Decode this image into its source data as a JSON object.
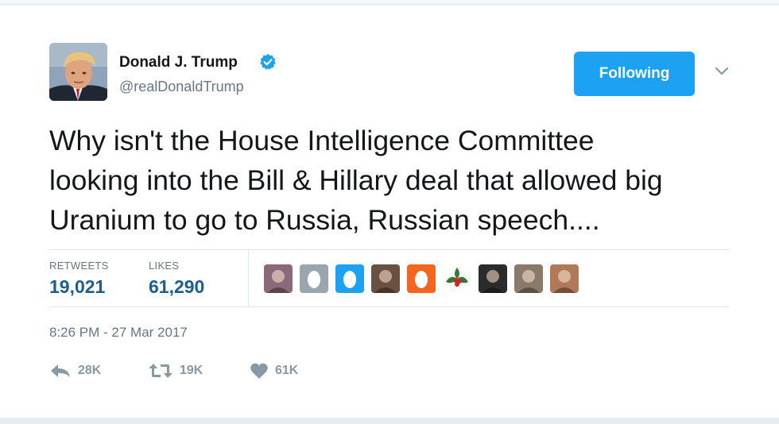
{
  "user": {
    "name": "Donald J. Trump",
    "handle": "@realDonaldTrump",
    "verified": true
  },
  "follow_button": {
    "label": "Following",
    "color": "#1da1f2"
  },
  "tweet": {
    "lines": [
      "Why isn't the House Intelligence Committee",
      "looking into the Bill & Hillary deal that allowed big",
      "Uranium to go to Russia, Russian speech...."
    ]
  },
  "stats": {
    "retweets_label": "RETWEETS",
    "retweets_value": "19,021",
    "likes_label": "LIKES",
    "likes_value": "61,290"
  },
  "likers": [
    {
      "kind": "photo",
      "color": "#8a6a7a"
    },
    {
      "kind": "egg",
      "color": "#9aa5ad"
    },
    {
      "kind": "egg",
      "color": "#1da1f2"
    },
    {
      "kind": "photo",
      "color": "#6a5040"
    },
    {
      "kind": "egg",
      "color": "#f4651f"
    },
    {
      "kind": "holly",
      "color": "#2e7d32"
    },
    {
      "kind": "photo",
      "color": "#2b2b2b"
    },
    {
      "kind": "photo",
      "color": "#8a7a6a"
    },
    {
      "kind": "photo",
      "color": "#b07a5a"
    }
  ],
  "timestamp": "8:26 PM - 27 Mar 2017",
  "actions": {
    "reply_count": "28K",
    "retweet_count": "19K",
    "like_count": "61K"
  },
  "colors": {
    "stat_value": "#1c5f8c",
    "secondary_text": "#657786",
    "action_icon": "#8899a6",
    "border": "#e1e8ed"
  }
}
